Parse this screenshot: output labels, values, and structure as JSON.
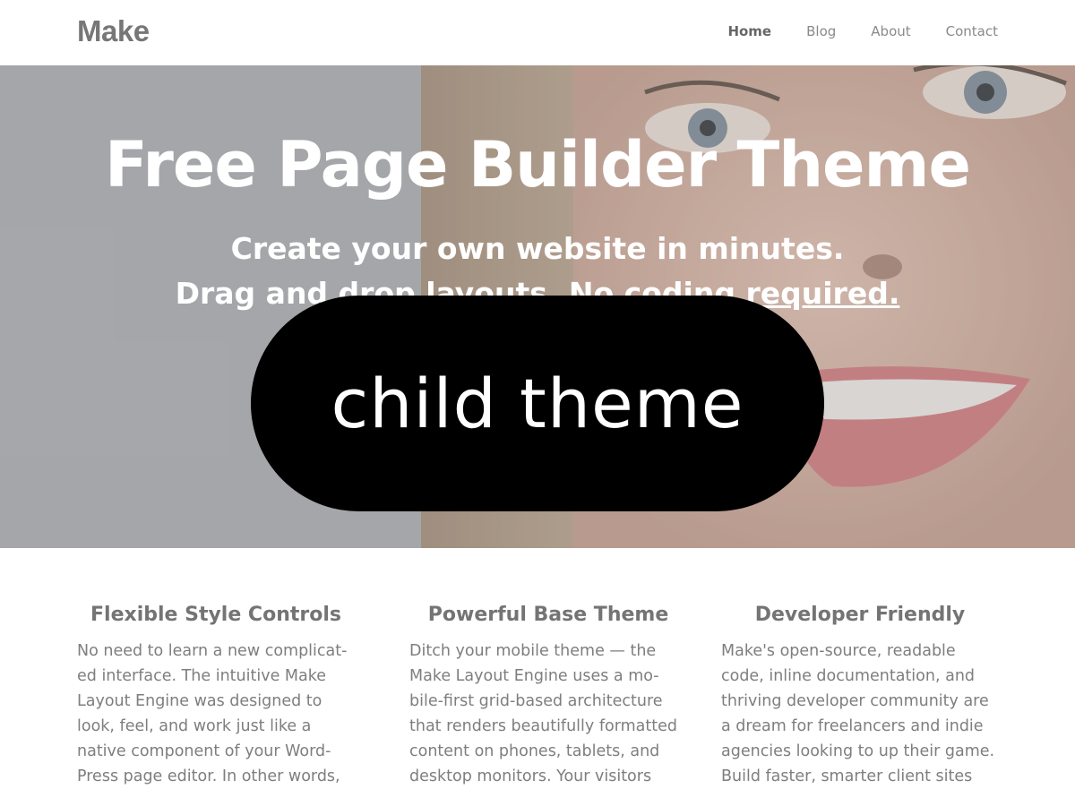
{
  "header": {
    "logo": "Make",
    "nav": [
      {
        "label": "Home",
        "active": true
      },
      {
        "label": "Blog",
        "active": false
      },
      {
        "label": "About",
        "active": false
      },
      {
        "label": "Contact",
        "active": false
      }
    ]
  },
  "hero": {
    "title": "Free Page Builder Theme",
    "subtitle_line1": "Create your own website in minutes.",
    "subtitle_line2_plain": "Drag and drop layouts. No coding ",
    "subtitle_line2_link": "required.",
    "badge": "child theme"
  },
  "features": [
    {
      "title": "Flexible Style Controls",
      "text": "No need to learn a new complicat-\ned interface. The intuitive Make\nLayout Engine was designed to\nlook, feel, and work just like a\nnative component of your Word-\nPress page editor. In other words,"
    },
    {
      "title": "Powerful Base Theme",
      "text": "Ditch your mobile theme — the\nMake Layout Engine uses a mo-\nbile-first grid-based architecture\nthat renders beautifully formatted\ncontent on phones, tablets, and\ndesktop monitors. Your visitors"
    },
    {
      "title": "Developer Friendly",
      "text": "Make's open-source, readable\ncode, inline documentation, and\nthriving developer community are\na dream for freelancers and indie\nagencies looking to up their game.\nBuild faster, smarter client sites"
    }
  ]
}
